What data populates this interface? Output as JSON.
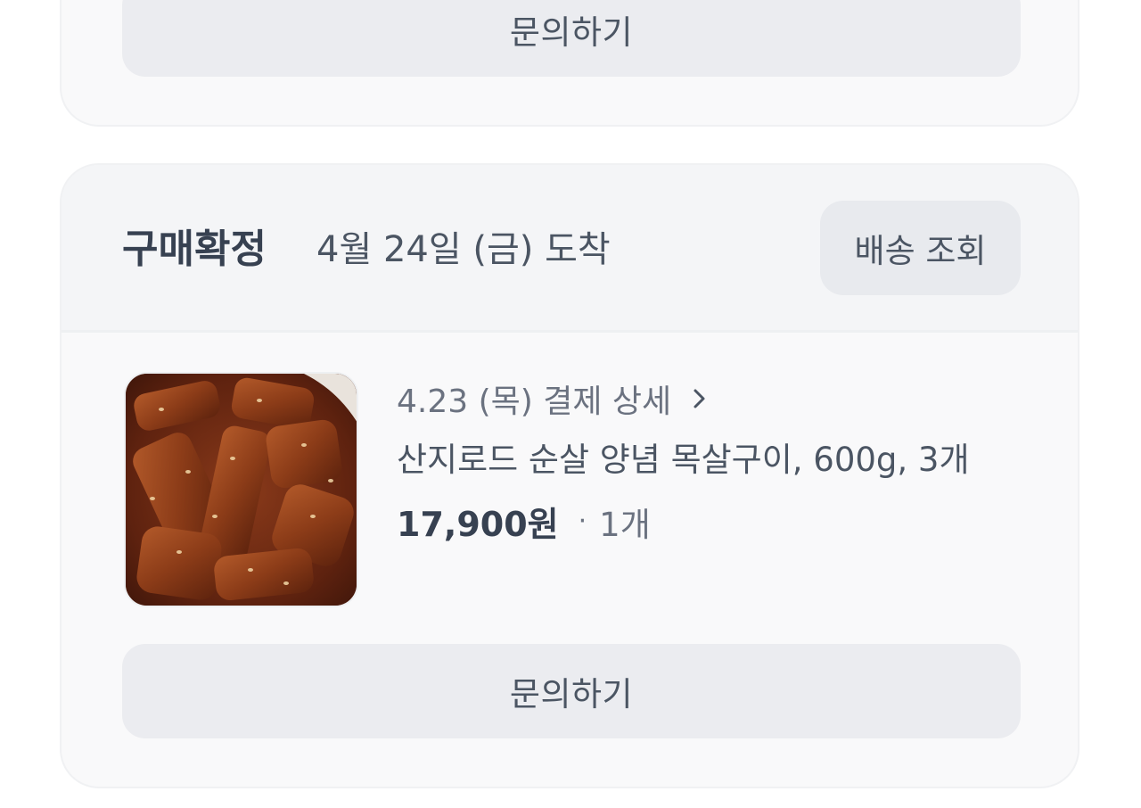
{
  "orders": [
    {
      "inquiry_label": "문의하기"
    },
    {
      "status": "구매확정",
      "arrival": "4월 24일 (금) 도착",
      "tracking_label": "배송 조회",
      "payment_detail_label": "4.23 (목) 결제 상세",
      "product_name": "산지로드 순살 양념 목살구이, 600g, 3개",
      "price": "17,900원",
      "separator": "·",
      "quantity": "1개",
      "inquiry_label": "문의하기",
      "image_icon": "food-photo-icon"
    }
  ],
  "colors": {
    "card_background": "#f9f9fa",
    "button_background": "#ebecf0",
    "primary_text": "#374151",
    "secondary_text": "#6b7280"
  }
}
